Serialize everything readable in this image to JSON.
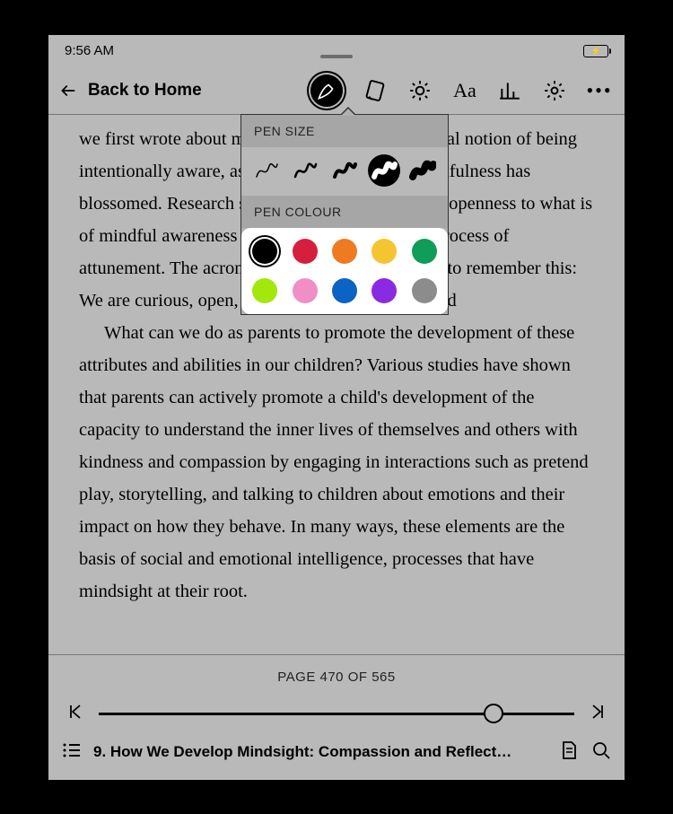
{
  "status": {
    "time": "9:56 AM"
  },
  "toolbar": {
    "back_label": "Back to Home"
  },
  "popover": {
    "size_header": "PEN SIZE",
    "colour_header": "PEN COLOUR",
    "sizes": [
      {
        "sw": 1.5,
        "selected": false
      },
      {
        "sw": 2.5,
        "selected": false
      },
      {
        "sw": 4,
        "selected": false
      },
      {
        "sw": 6,
        "selected": true
      },
      {
        "sw": 8,
        "selected": false
      }
    ],
    "colors": [
      {
        "hex": "#000000",
        "selected": true
      },
      {
        "hex": "#d61f3d",
        "selected": false
      },
      {
        "hex": "#ee7b22",
        "selected": false
      },
      {
        "hex": "#f5c531",
        "selected": false
      },
      {
        "hex": "#0f9d58",
        "selected": false
      },
      {
        "hex": "#a2e80c",
        "selected": false
      },
      {
        "hex": "#ef8fc5",
        "selected": false
      },
      {
        "hex": "#0b63c4",
        "selected": false
      },
      {
        "hex": "#8a2be2",
        "selected": false
      },
      {
        "hex": "#8c8c8c",
        "selected": false
      }
    ]
  },
  "body": {
    "p1": "we first wrote about mindful awareness, the general notion of being intentionally aware, as well as the science of mindfulness has blossomed. Research shows that the presence and openness to what is of mindful awareness overlaps directly with the process of attunement. The acronym COAL is a helpful way to remember this: We are curious, open, accepting, and loving toward",
    "p2": "What can we do as parents to promote the development of these attributes and abilities in our children? Various studies have shown that parents can actively promote a child's development of the capacity to understand the inner lives of themselves and others with kindness and compassion by engaging in interactions such as pretend play, storytelling, and talking to children about emotions and their impact on how they behave. In many ways, these elements are the basis of social and emotional intelligence, processes that have mindsight at their root."
  },
  "footer": {
    "page_label": "PAGE 470 OF 565",
    "chapter": "9. How We Develop Mindsight: Compassion and Reflect…",
    "progress_pct": 83
  }
}
